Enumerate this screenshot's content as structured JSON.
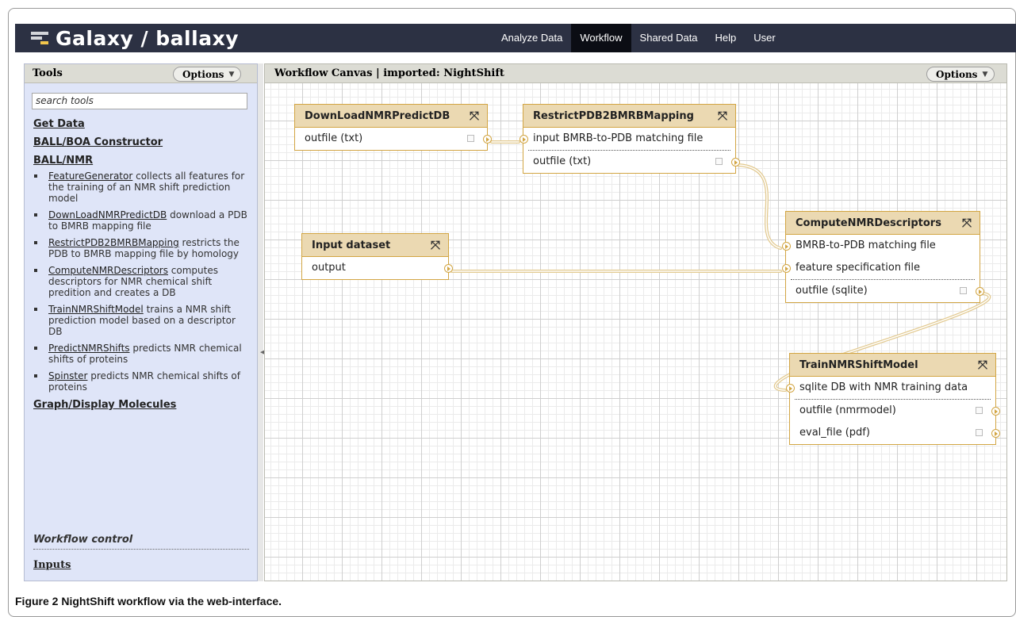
{
  "app": {
    "brand": "Galaxy / ballaxy"
  },
  "nav": [
    {
      "label": "Analyze Data",
      "active": false
    },
    {
      "label": "Workflow",
      "active": true
    },
    {
      "label": "Shared Data",
      "active": false
    },
    {
      "label": "Help",
      "active": false
    },
    {
      "label": "User",
      "active": false
    }
  ],
  "tools_panel": {
    "title": "Tools",
    "options_label": "Options",
    "search_placeholder": "search tools",
    "sections": {
      "get_data": "Get Data",
      "ball_boa": "BALL/BOA Constructor",
      "ball_nmr": "BALL/NMR",
      "graph": "Graph/Display Molecules"
    },
    "tools": [
      {
        "name": "FeatureGenerator",
        "desc": " collects all features for the training of an NMR shift prediction model"
      },
      {
        "name": "DownLoadNMRPredictDB",
        "desc": " download a PDB to BMRB mapping file"
      },
      {
        "name": "RestrictPDB2BMRBMapping",
        "desc": " restricts the PDB to BMRB mapping file by homology"
      },
      {
        "name": "ComputeNMRDescriptors",
        "desc": " computes descriptors for NMR chemical shift predition and creates a DB"
      },
      {
        "name": "TrainNMRShiftModel",
        "desc": " trains a NMR shift prediction model based on a descriptor DB"
      },
      {
        "name": "PredictNMRShifts",
        "desc": " predicts NMR chemical shifts of proteins"
      },
      {
        "name": "Spinster",
        "desc": " predicts NMR chemical shifts of proteins"
      }
    ],
    "workflow_control": "Workflow control",
    "inputs_link": "Inputs"
  },
  "canvas": {
    "title": "Workflow Canvas | imported: NightShift",
    "options_label": "Options",
    "nodes": {
      "download": {
        "title": "DownLoadNMRPredictDB",
        "outputs": [
          "outfile (txt)"
        ]
      },
      "restrict": {
        "title": "RestrictPDB2BMRBMapping",
        "inputs": [
          "input BMRB-to-PDB matching file"
        ],
        "outputs": [
          "outfile (txt)"
        ]
      },
      "input": {
        "title": "Input dataset",
        "outputs": [
          "output"
        ]
      },
      "compute": {
        "title": "ComputeNMRDescriptors",
        "inputs": [
          "BMRB-to-PDB matching file",
          "feature specification file"
        ],
        "outputs": [
          "outfile (sqlite)"
        ]
      },
      "train": {
        "title": "TrainNMRShiftModel",
        "inputs": [
          "sqlite DB with NMR training data"
        ],
        "outputs": [
          "outfile (nmrmodel)",
          "eval_file (pdf)"
        ]
      }
    },
    "close_glyph": "⤧"
  },
  "caption": {
    "label": "Figure 2",
    "text": " NightShift workflow via the web-interface."
  },
  "colors": {
    "masthead": "#2c3143",
    "node_header": "#ebd9b2",
    "node_border": "#d2a543",
    "connector": "#e2c98f",
    "panel_bg": "#dfe5f8"
  }
}
